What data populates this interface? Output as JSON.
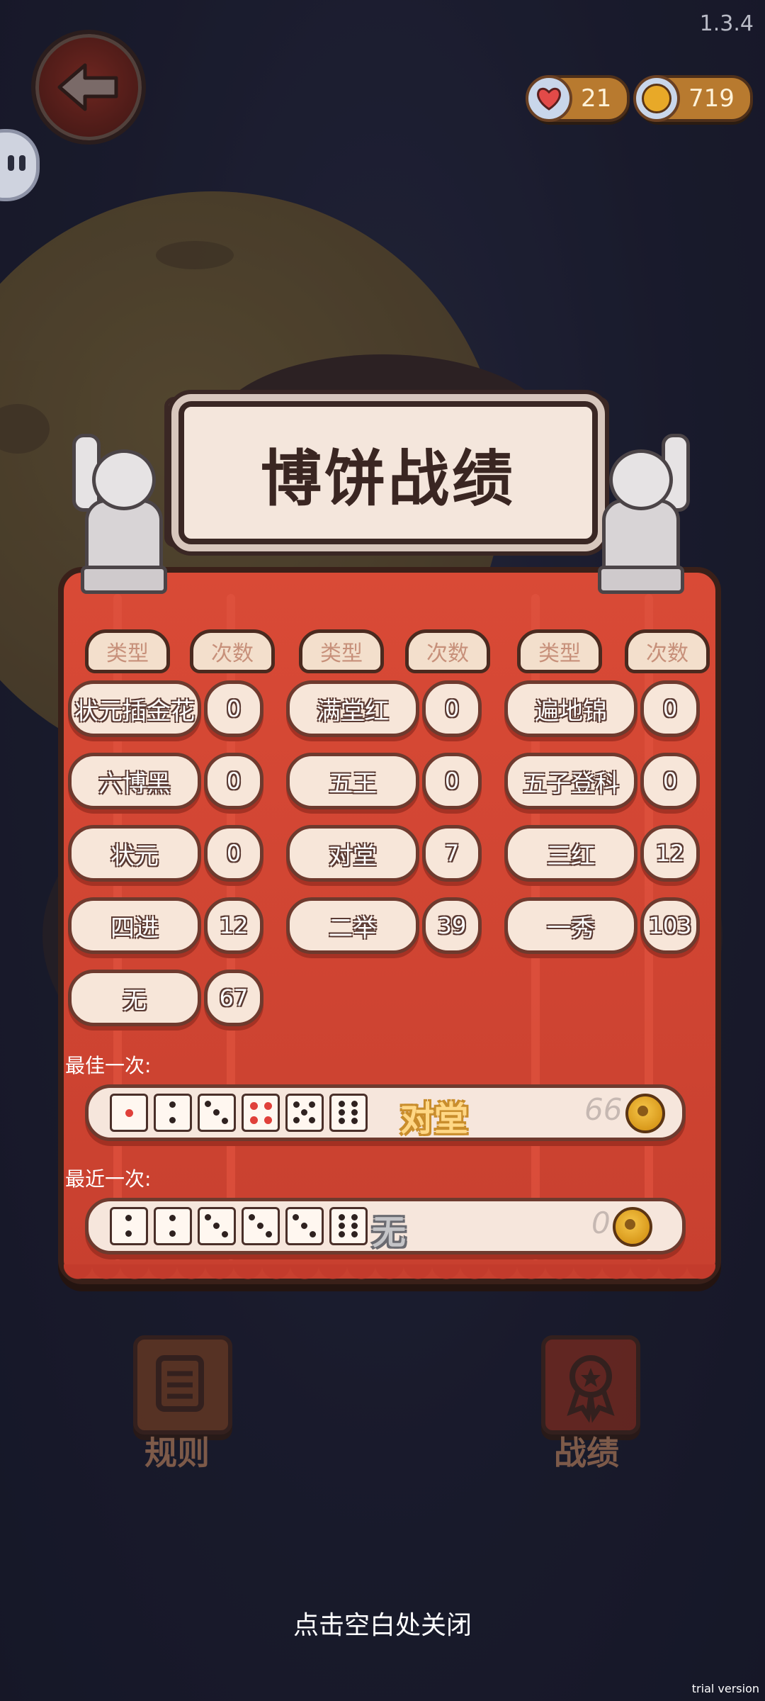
{
  "header": {
    "version": "1.3.4",
    "hearts": "21",
    "coins": "719"
  },
  "panel": {
    "title": "博饼战绩",
    "column_headers": [
      "类型",
      "次数",
      "类型",
      "次数",
      "类型",
      "次数"
    ],
    "rows": [
      [
        {
          "type": "状元插金花",
          "count": "0"
        },
        {
          "type": "满堂红",
          "count": "0"
        },
        {
          "type": "遍地锦",
          "count": "0"
        }
      ],
      [
        {
          "type": "六博黑",
          "count": "0"
        },
        {
          "type": "五王",
          "count": "0"
        },
        {
          "type": "五子登科",
          "count": "0"
        }
      ],
      [
        {
          "type": "状元",
          "count": "0"
        },
        {
          "type": "对堂",
          "count": "7"
        },
        {
          "type": "三红",
          "count": "12"
        }
      ],
      [
        {
          "type": "四进",
          "count": "12"
        },
        {
          "type": "二举",
          "count": "39"
        },
        {
          "type": "一秀",
          "count": "103"
        }
      ],
      [
        {
          "type": "无",
          "count": "67"
        }
      ]
    ],
    "best": {
      "label": "最佳一次:",
      "dice": [
        1,
        2,
        3,
        4,
        5,
        6
      ],
      "result": "对堂",
      "coins": "66"
    },
    "recent": {
      "label": "最近一次:",
      "dice": [
        2,
        2,
        3,
        3,
        3,
        6
      ],
      "result": "无",
      "coins": "0"
    }
  },
  "bottom": {
    "rules_label": "规则",
    "record_label": "战绩",
    "close_hint": "点击空白处关闭"
  },
  "watermark": "trial version"
}
